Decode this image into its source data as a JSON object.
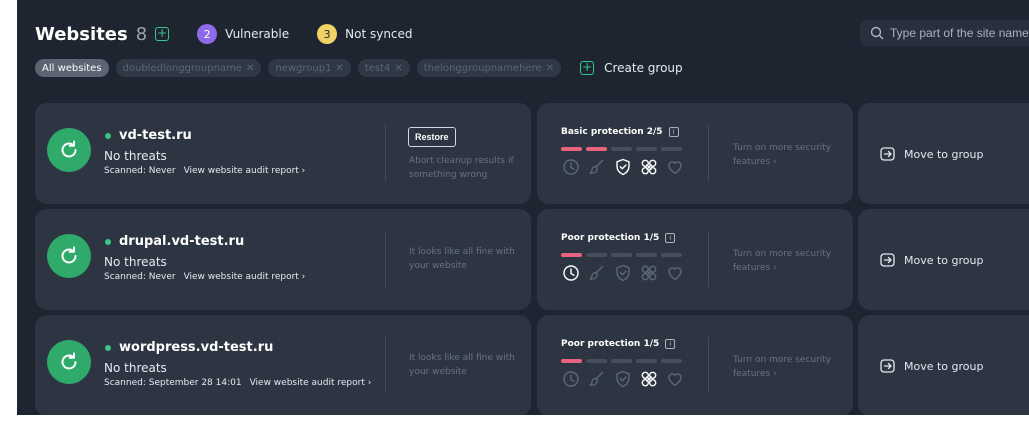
{
  "header": {
    "title": "Websites",
    "count": "8",
    "vulnerable_count": "2",
    "vulnerable_label": "Vulnerable",
    "not_synced_count": "3",
    "not_synced_label": "Not synced"
  },
  "search": {
    "placeholder": "Type part of the site name"
  },
  "groups": {
    "all_label": "All websites",
    "items": [
      "doubledlonggroupname",
      "newgroup1",
      "test4",
      "thelonggroupnamehere"
    ],
    "remove_glyph": "✕",
    "create_label": "Create group"
  },
  "sites": [
    {
      "domain": "vd-test.ru",
      "threats": "No threats",
      "scanned": "Scanned: Never",
      "audit_link": "View website audit report ›",
      "restore_label": "Restore",
      "note": "Abort cleanup results if something wrong",
      "protection_label": "Basic protection 2/5",
      "protection_level": 2,
      "protection_max": 5,
      "active_icons": [
        "shield-check",
        "cross-puzzle"
      ],
      "turn_on": "Turn on more security features ›",
      "move_label": "Move to group"
    },
    {
      "domain": "drupal.vd-test.ru",
      "threats": "No threats",
      "scanned": "Scanned: Never",
      "audit_link": "View website audit report ›",
      "note": "It looks like all fine with your website",
      "protection_label": "Poor protection 1/5",
      "protection_level": 1,
      "protection_max": 5,
      "active_icons": [
        "clock"
      ],
      "turn_on": "Turn on more security features ›",
      "move_label": "Move to group"
    },
    {
      "domain": "wordpress.vd-test.ru",
      "threats": "No threats",
      "scanned": "Scanned: September 28 14:01",
      "audit_link": "View website audit report ›",
      "note": "It looks like all fine with your website",
      "protection_label": "Poor protection 1/5",
      "protection_level": 1,
      "protection_max": 5,
      "active_icons": [
        "cross-puzzle"
      ],
      "turn_on": "Turn on more security features ›",
      "move_label": "Move to group"
    }
  ],
  "colors": {
    "background": "#1e2530",
    "card": "#2c3541",
    "accent_green": "#2faa6a",
    "protection_bar": "#e9637a",
    "vulnerable": "#8b6be8",
    "not_synced": "#f0d266"
  },
  "icons": {
    "security_features": [
      "clock",
      "brush",
      "shield-check",
      "cross-puzzle",
      "heart"
    ],
    "status": "refresh-icon",
    "move": "move-to-group-icon",
    "search": "search-icon"
  }
}
